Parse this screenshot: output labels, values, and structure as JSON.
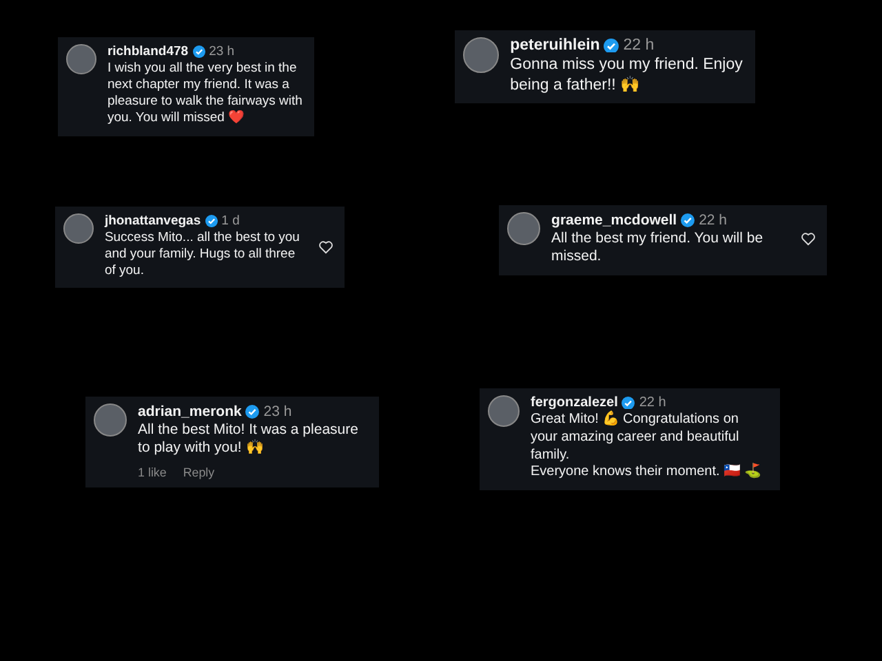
{
  "comments": [
    {
      "username": "richbland478",
      "time": "23 h",
      "text": "I wish you all the very best in the next chapter my friend. It was a pleasure to walk the fairways with you. You will missed ❤️",
      "like_button": false
    },
    {
      "username": "peteruihlein",
      "time": "22 h",
      "text": "Gonna miss you my friend. Enjoy being a father!! 🙌",
      "like_button": false
    },
    {
      "username": "jhonattanvegas",
      "time": "1 d",
      "text": "Success Mito... all the best to you and your family. Hugs to all three of you.",
      "like_button": true
    },
    {
      "username": "graeme_mcdowell",
      "time": "22 h",
      "text": "All the best my friend. You will be missed.",
      "like_button": true
    },
    {
      "username": "adrian_meronk",
      "time": "23 h",
      "text": "All the best Mito! It was a pleasure to play with you! 🙌",
      "like_button": false,
      "likes": "1 like",
      "reply": "Reply"
    },
    {
      "username": "fergonzalezel",
      "time": "22 h",
      "text": "Great Mito! 💪 Congratulations on your amazing career and beautiful family.\nEveryone knows their moment. 🇨🇱 ⛳",
      "like_button": false
    }
  ]
}
